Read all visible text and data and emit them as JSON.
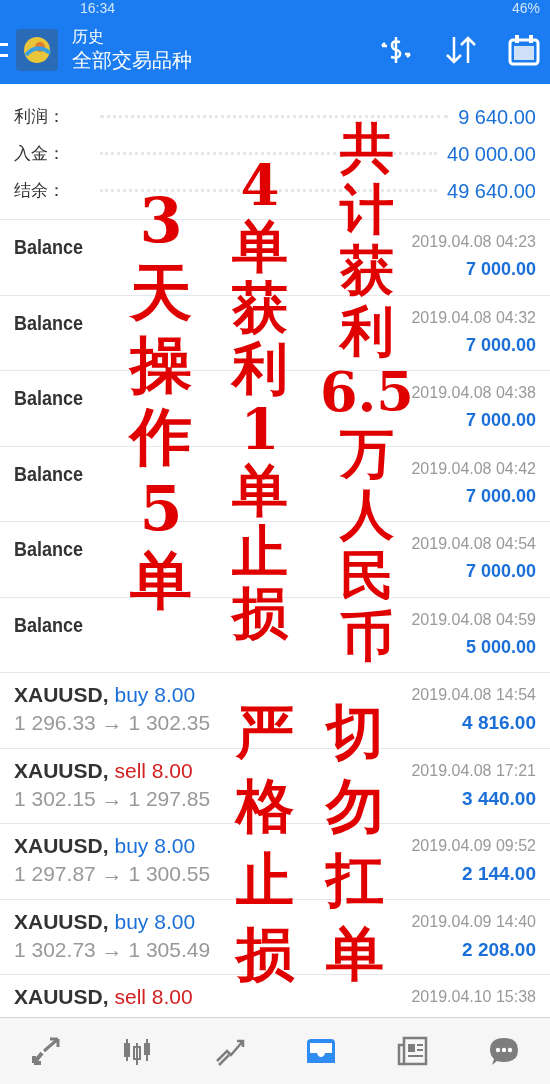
{
  "status_bar": {
    "time": "16:34",
    "battery": "46%"
  },
  "header": {
    "title": "历史",
    "subtitle": "全部交易品种"
  },
  "summary": [
    {
      "label": "利润：",
      "value": "9 640.00"
    },
    {
      "label": "入金：",
      "value": "40 000.00"
    },
    {
      "label": "结余：",
      "value": "49 640.00"
    }
  ],
  "deals": [
    {
      "kind": "balance",
      "symbol": "Balance",
      "time": "2019.04.08 04:23",
      "amount": "7 000.00"
    },
    {
      "kind": "balance",
      "symbol": "Balance",
      "time": "2019.04.08 04:32",
      "amount": "7 000.00"
    },
    {
      "kind": "balance",
      "symbol": "Balance",
      "time": "2019.04.08 04:38",
      "amount": "7 000.00"
    },
    {
      "kind": "balance",
      "symbol": "Balance",
      "time": "2019.04.08 04:42",
      "amount": "7 000.00"
    },
    {
      "kind": "balance",
      "symbol": "Balance",
      "time": "2019.04.08 04:54",
      "amount": "7 000.00"
    },
    {
      "kind": "balance",
      "symbol": "Balance",
      "time": "2019.04.08 04:59",
      "amount": "5 000.00"
    },
    {
      "kind": "buy",
      "symbol": "XAUUSD,",
      "volume": "buy 8.00",
      "prices": "1 296.33 → 1 302.35",
      "time": "2019.04.08 14:54",
      "amount": "4 816.00"
    },
    {
      "kind": "sell",
      "symbol": "XAUUSD,",
      "volume": "sell 8.00",
      "prices": "1 302.15 → 1 297.85",
      "time": "2019.04.08 17:21",
      "amount": "3 440.00"
    },
    {
      "kind": "buy",
      "symbol": "XAUUSD,",
      "volume": "buy 8.00",
      "prices": "1 297.87 → 1 300.55",
      "time": "2019.04.09 09:52",
      "amount": "2 144.00"
    },
    {
      "kind": "buy",
      "symbol": "XAUUSD,",
      "volume": "buy 8.00",
      "prices": "1 302.73 → 1 305.49",
      "time": "2019.04.09 14:40",
      "amount": "2 208.00"
    },
    {
      "kind": "sell",
      "symbol": "XAUUSD,",
      "volume": "sell 8.00",
      "time": "2019.04.10 15:38"
    }
  ],
  "tab_bar": [
    {
      "selected": false
    },
    {
      "selected": false
    },
    {
      "selected": false
    },
    {
      "selected": true
    },
    {
      "selected": false
    },
    {
      "selected": false
    }
  ],
  "annotations": [
    {
      "lines": [
        "3",
        "天",
        "操",
        "作",
        "5",
        "单"
      ]
    },
    {
      "lines": [
        "4",
        "单",
        "获",
        "利",
        "1",
        "单",
        "止",
        "损"
      ]
    },
    {
      "lines": [
        "共",
        "计",
        "获",
        "利",
        "6.5",
        "万",
        "人",
        "民",
        "币"
      ]
    },
    {
      "lines": [
        "严",
        "格",
        "止",
        "损"
      ]
    },
    {
      "lines": [
        "切",
        "勿",
        "扛",
        "单"
      ]
    }
  ]
}
